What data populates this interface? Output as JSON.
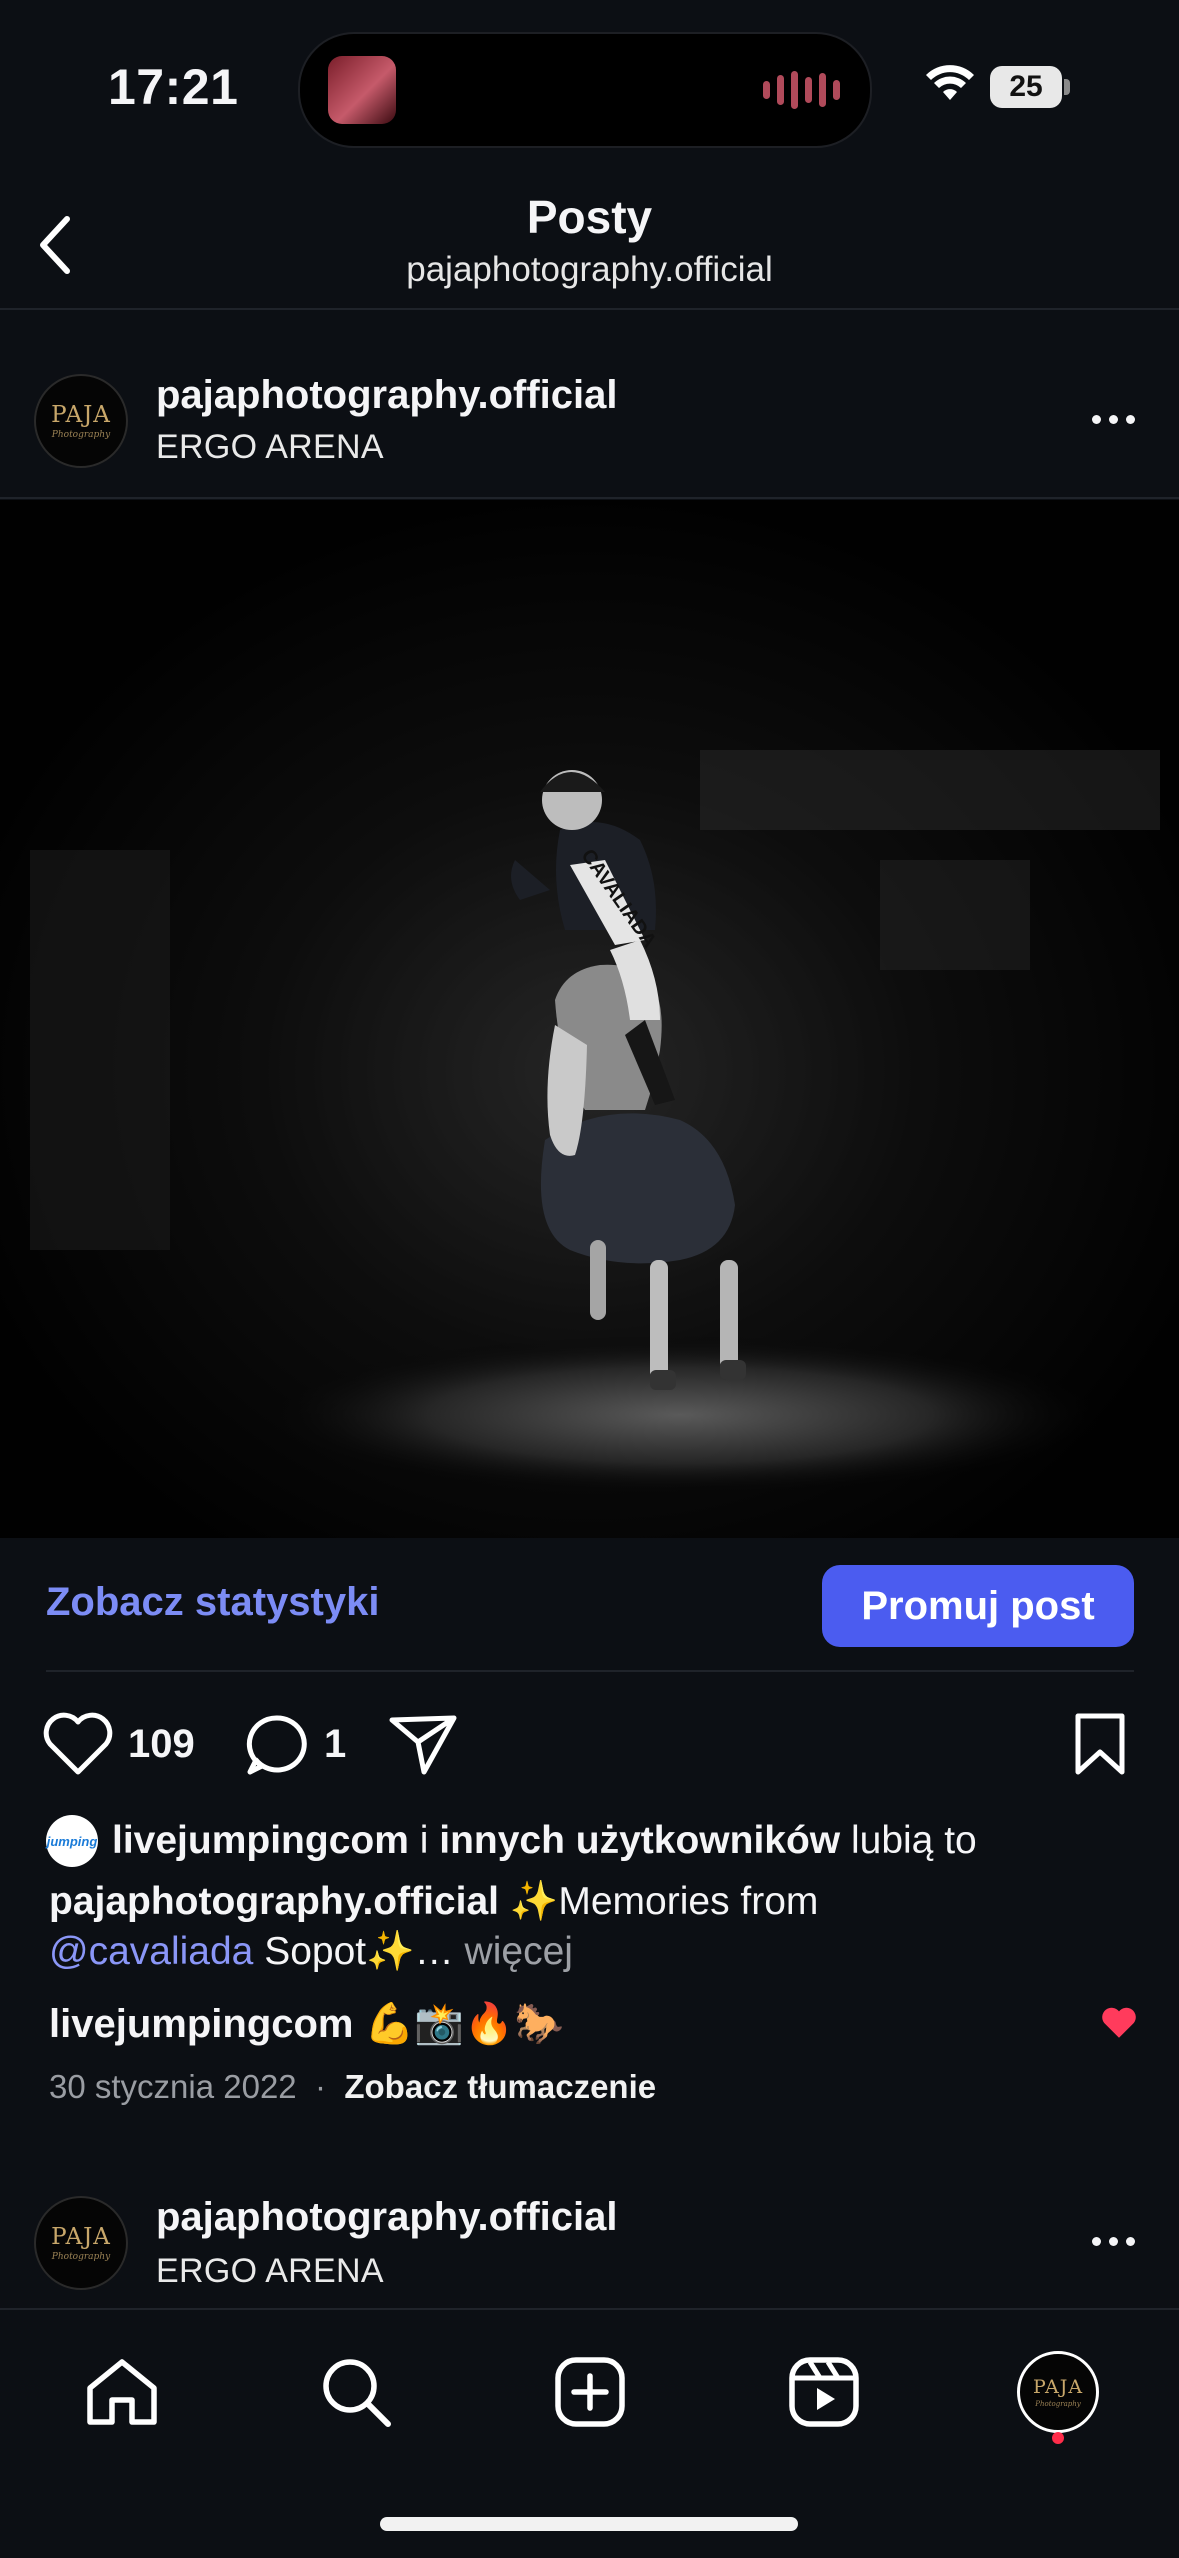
{
  "status_bar": {
    "time": "17:21",
    "battery": "25"
  },
  "header": {
    "title": "Posty",
    "subtitle": "pajaphotography.official"
  },
  "post": {
    "username": "pajaphotography.official",
    "location": "ERGO ARENA",
    "avatar_logo": "PAJA",
    "avatar_logo_sub": "Photography",
    "photo_saddle_text": "CAVALIADA",
    "insights_link": "Zobacz statystyki",
    "promote_button": "Promuj post",
    "likes_count": "109",
    "comments_count": "1",
    "liked_by_avatar": "jumping",
    "liked_by_user": "livejumpingcom",
    "liked_by_connector": "i",
    "liked_by_others": "innych użytkowników",
    "liked_by_suffix": "lubią to",
    "caption_user": "pajaphotography.official",
    "caption_text": "✨Memories from",
    "caption_mention": "@cavaliada",
    "caption_text2": "Sopot✨…",
    "caption_more": "więcej",
    "comment_user": "livejumpingcom",
    "comment_text": "💪📸🔥🐎",
    "date": "30 stycznia 2022",
    "date_separator": "·",
    "translate_link": "Zobacz tłumaczenie"
  },
  "next_post": {
    "username": "pajaphotography.official",
    "location": "ERGO ARENA"
  },
  "tabbar": {
    "items": [
      "home-icon",
      "search-icon",
      "create-icon",
      "reels-icon",
      "profile-avatar"
    ]
  },
  "colors": {
    "accent": "#4b5cf0",
    "link": "#7c8cf5",
    "background": "#0c0f14",
    "like": "#ff3b5c"
  }
}
